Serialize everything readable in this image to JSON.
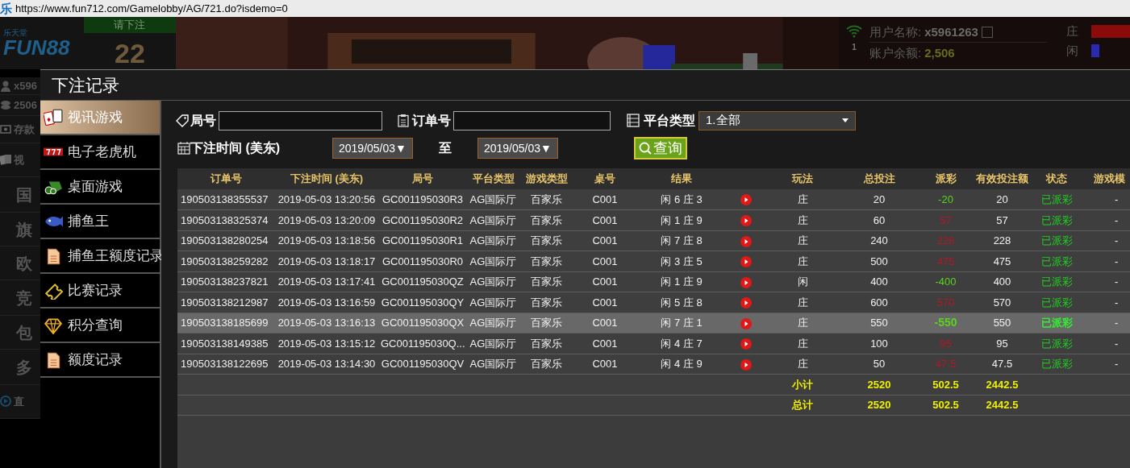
{
  "browser": {
    "tab_icon": "乐",
    "url": "https://www.fun712.com/Gamelobby/AG/721.do?isdemo=0"
  },
  "lobby": {
    "logo_small": "乐天堂",
    "logo": "FUN88",
    "bet_prompt": "请下注",
    "countdown": "22",
    "user_label": "用户名称:",
    "username": "x5961263",
    "balance_label": "账户余额:",
    "balance": "2,506",
    "network_count": "1",
    "roadmap": [
      {
        "label": "庄",
        "color": "#8b0a0a"
      },
      {
        "label": "闲",
        "color": "#2a2ab0"
      }
    ],
    "side_items": [
      {
        "label": "x596",
        "kind": "user"
      },
      {
        "label": "2506",
        "kind": "coins"
      },
      {
        "label": "存款",
        "kind": "deposit"
      },
      {
        "label": "视",
        "kind": "cards"
      },
      {
        "label": "国",
        "kind": "plain"
      },
      {
        "label": "旗",
        "kind": "plain"
      },
      {
        "label": "欧",
        "kind": "plain"
      },
      {
        "label": "竞",
        "kind": "plain"
      },
      {
        "label": "包",
        "kind": "plain"
      },
      {
        "label": "多",
        "kind": "plain"
      },
      {
        "label": "直",
        "kind": "live"
      }
    ]
  },
  "modal": {
    "title": "下注记录",
    "sidebar": [
      {
        "label": "视讯游戏",
        "kind": "cards",
        "selected": true
      },
      {
        "label": "电子老虎机",
        "kind": "slots",
        "selected": false
      },
      {
        "label": "桌面游戏",
        "kind": "chips",
        "selected": false
      },
      {
        "label": "捕鱼王",
        "kind": "fish",
        "selected": false
      },
      {
        "label": "捕鱼王额度记录",
        "kind": "doc",
        "selected": false
      },
      {
        "label": "比赛记录",
        "kind": "ticket",
        "selected": false
      },
      {
        "label": "积分查询",
        "kind": "diamond",
        "selected": false
      },
      {
        "label": "额度记录",
        "kind": "doc",
        "selected": false
      }
    ],
    "filters": {
      "round_label": "局号",
      "order_label": "订单号",
      "platform_label": "平台类型",
      "platform_value": "1.全部",
      "time_label": "下注时间 (美东)",
      "date_from": "2019/05/03▼",
      "to_label": "至",
      "date_to": "2019/05/03▼",
      "query_button": "查询"
    },
    "table": {
      "columns": [
        "订单号",
        "下注时间 (美东)",
        "局号",
        "平台类型",
        "游戏类型",
        "桌号",
        "结果",
        "",
        "玩法",
        "总投注",
        "派彩",
        "有效投注额",
        "状态",
        "游戏模"
      ],
      "rows": [
        {
          "order": "190503138355537",
          "time": "2019-05-03 13:20:56",
          "round": "GC001195030R3",
          "platform": "AG国际厅",
          "game": "百家乐",
          "table": "C001",
          "result": "闲 6 庄 3",
          "bet_type": "庄",
          "bet": "20",
          "payout": {
            "text": "-20",
            "color": "#5ad21e"
          },
          "valid_bet": "20",
          "status": "已派彩",
          "mode": "-",
          "selected": false
        },
        {
          "order": "190503138325374",
          "time": "2019-05-03 13:20:09",
          "round": "GC001195030R2",
          "platform": "AG国际厅",
          "game": "百家乐",
          "table": "C001",
          "result": "闲 1 庄 9",
          "bet_type": "庄",
          "bet": "60",
          "payout": {
            "text": "57",
            "color": "#b01828"
          },
          "valid_bet": "57",
          "status": "已派彩",
          "mode": "-",
          "selected": false
        },
        {
          "order": "190503138280254",
          "time": "2019-05-03 13:18:56",
          "round": "GC001195030R1",
          "platform": "AG国际厅",
          "game": "百家乐",
          "table": "C001",
          "result": "闲 7 庄 8",
          "bet_type": "庄",
          "bet": "240",
          "payout": {
            "text": "228",
            "color": "#b01828"
          },
          "valid_bet": "228",
          "status": "已派彩",
          "mode": "-",
          "selected": false
        },
        {
          "order": "190503138259282",
          "time": "2019-05-03 13:18:17",
          "round": "GC001195030R0",
          "platform": "AG国际厅",
          "game": "百家乐",
          "table": "C001",
          "result": "闲 3 庄 5",
          "bet_type": "庄",
          "bet": "500",
          "payout": {
            "text": "475",
            "color": "#b01828"
          },
          "valid_bet": "475",
          "status": "已派彩",
          "mode": "-",
          "selected": false
        },
        {
          "order": "190503138237821",
          "time": "2019-05-03 13:17:41",
          "round": "GC001195030QZ",
          "platform": "AG国际厅",
          "game": "百家乐",
          "table": "C001",
          "result": "闲 1 庄 9",
          "bet_type": "闲",
          "bet": "400",
          "payout": {
            "text": "-400",
            "color": "#5ad21e"
          },
          "valid_bet": "400",
          "status": "已派彩",
          "mode": "-",
          "selected": false
        },
        {
          "order": "190503138212987",
          "time": "2019-05-03 13:16:59",
          "round": "GC001195030QY",
          "platform": "AG国际厅",
          "game": "百家乐",
          "table": "C001",
          "result": "闲 5 庄 8",
          "bet_type": "庄",
          "bet": "600",
          "payout": {
            "text": "570",
            "color": "#b01828"
          },
          "valid_bet": "570",
          "status": "已派彩",
          "mode": "-",
          "selected": false
        },
        {
          "order": "190503138185699",
          "time": "2019-05-03 13:16:13",
          "round": "GC001195030QX",
          "platform": "AG国际厅",
          "game": "百家乐",
          "table": "C001",
          "result": "闲 7 庄 1",
          "bet_type": "庄",
          "bet": "550",
          "payout": {
            "text": "-550",
            "color": "#5ad21e"
          },
          "valid_bet": "550",
          "status": "已派彩",
          "mode": "-",
          "selected": true
        },
        {
          "order": "190503138149385",
          "time": "2019-05-03 13:15:12",
          "round": "GC001195030Q...",
          "platform": "AG国际厅",
          "game": "百家乐",
          "table": "C001",
          "result": "闲 4 庄 7",
          "bet_type": "庄",
          "bet": "100",
          "payout": {
            "text": "95",
            "color": "#b01828"
          },
          "valid_bet": "95",
          "status": "已派彩",
          "mode": "-",
          "selected": false
        },
        {
          "order": "190503138122695",
          "time": "2019-05-03 13:14:30",
          "round": "GC001195030QV",
          "platform": "AG国际厅",
          "game": "百家乐",
          "table": "C001",
          "result": "闲 4 庄 9",
          "bet_type": "庄",
          "bet": "50",
          "payout": {
            "text": "47.5",
            "color": "#b01828"
          },
          "valid_bet": "47.5",
          "status": "已派彩",
          "mode": "-",
          "selected": false
        }
      ],
      "totals": [
        {
          "label": "小计",
          "bet": "2520",
          "payout": "502.5",
          "valid_bet": "2442.5"
        },
        {
          "label": "总计",
          "bet": "2520",
          "payout": "502.5",
          "valid_bet": "2442.5"
        }
      ]
    }
  }
}
